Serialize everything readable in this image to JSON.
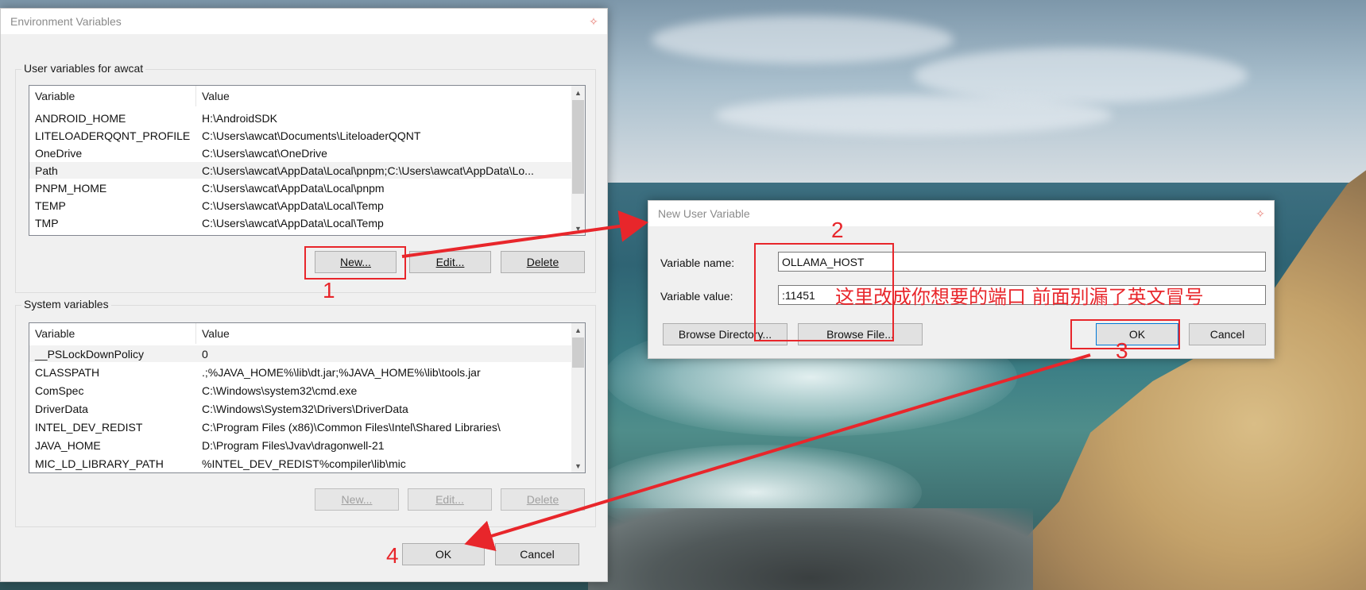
{
  "env_dialog": {
    "title": "Environment Variables",
    "user_group_label": "User variables for awcat",
    "system_group_label": "System variables",
    "columns": {
      "variable": "Variable",
      "value": "Value"
    },
    "user_vars": [
      {
        "name": "ANDROID_HOME",
        "value": "H:\\AndroidSDK"
      },
      {
        "name": "LITELOADERQQNT_PROFILE",
        "value": "C:\\Users\\awcat\\Documents\\LiteloaderQQNT"
      },
      {
        "name": "OneDrive",
        "value": "C:\\Users\\awcat\\OneDrive"
      },
      {
        "name": "Path",
        "value": "C:\\Users\\awcat\\AppData\\Local\\pnpm;C:\\Users\\awcat\\AppData\\Lo..."
      },
      {
        "name": "PNPM_HOME",
        "value": "C:\\Users\\awcat\\AppData\\Local\\pnpm"
      },
      {
        "name": "TEMP",
        "value": "C:\\Users\\awcat\\AppData\\Local\\Temp"
      },
      {
        "name": "TMP",
        "value": "C:\\Users\\awcat\\AppData\\Local\\Temp"
      }
    ],
    "system_vars": [
      {
        "name": "__PSLockDownPolicy",
        "value": "0"
      },
      {
        "name": "CLASSPATH",
        "value": ".;%JAVA_HOME%\\lib\\dt.jar;%JAVA_HOME%\\lib\\tools.jar"
      },
      {
        "name": "ComSpec",
        "value": "C:\\Windows\\system32\\cmd.exe"
      },
      {
        "name": "DriverData",
        "value": "C:\\Windows\\System32\\Drivers\\DriverData"
      },
      {
        "name": "INTEL_DEV_REDIST",
        "value": "C:\\Program Files (x86)\\Common Files\\Intel\\Shared Libraries\\"
      },
      {
        "name": "JAVA_HOME",
        "value": "D:\\Program Files\\Jvav\\dragonwell-21"
      },
      {
        "name": "MIC_LD_LIBRARY_PATH",
        "value": "%INTEL_DEV_REDIST%compiler\\lib\\mic"
      }
    ],
    "user_buttons": {
      "new_label": "New...",
      "edit_label": "Edit...",
      "delete_label": "Delete"
    },
    "system_buttons": {
      "new_label": "New...",
      "edit_label": "Edit...",
      "delete_label": "Delete"
    },
    "ok_label": "OK",
    "cancel_label": "Cancel"
  },
  "new_var_dialog": {
    "title": "New User Variable",
    "name_label": "Variable name:",
    "value_label": "Variable value:",
    "name_value": "OLLAMA_HOST",
    "value_value": ":11451",
    "browse_directory_label": "Browse Directory...",
    "browse_file_label": "Browse File...",
    "ok_label": "OK",
    "cancel_label": "Cancel"
  },
  "annotations": {
    "step1": "1",
    "step2": "2",
    "step3": "3",
    "step4": "4",
    "note": "这里改成你想要的端口 前面别漏了英文冒号",
    "color": "#e8262b"
  },
  "icons": {
    "title_icon": "pin-icon",
    "scroll_up": "scroll-up-icon",
    "scroll_down": "scroll-down-icon"
  }
}
